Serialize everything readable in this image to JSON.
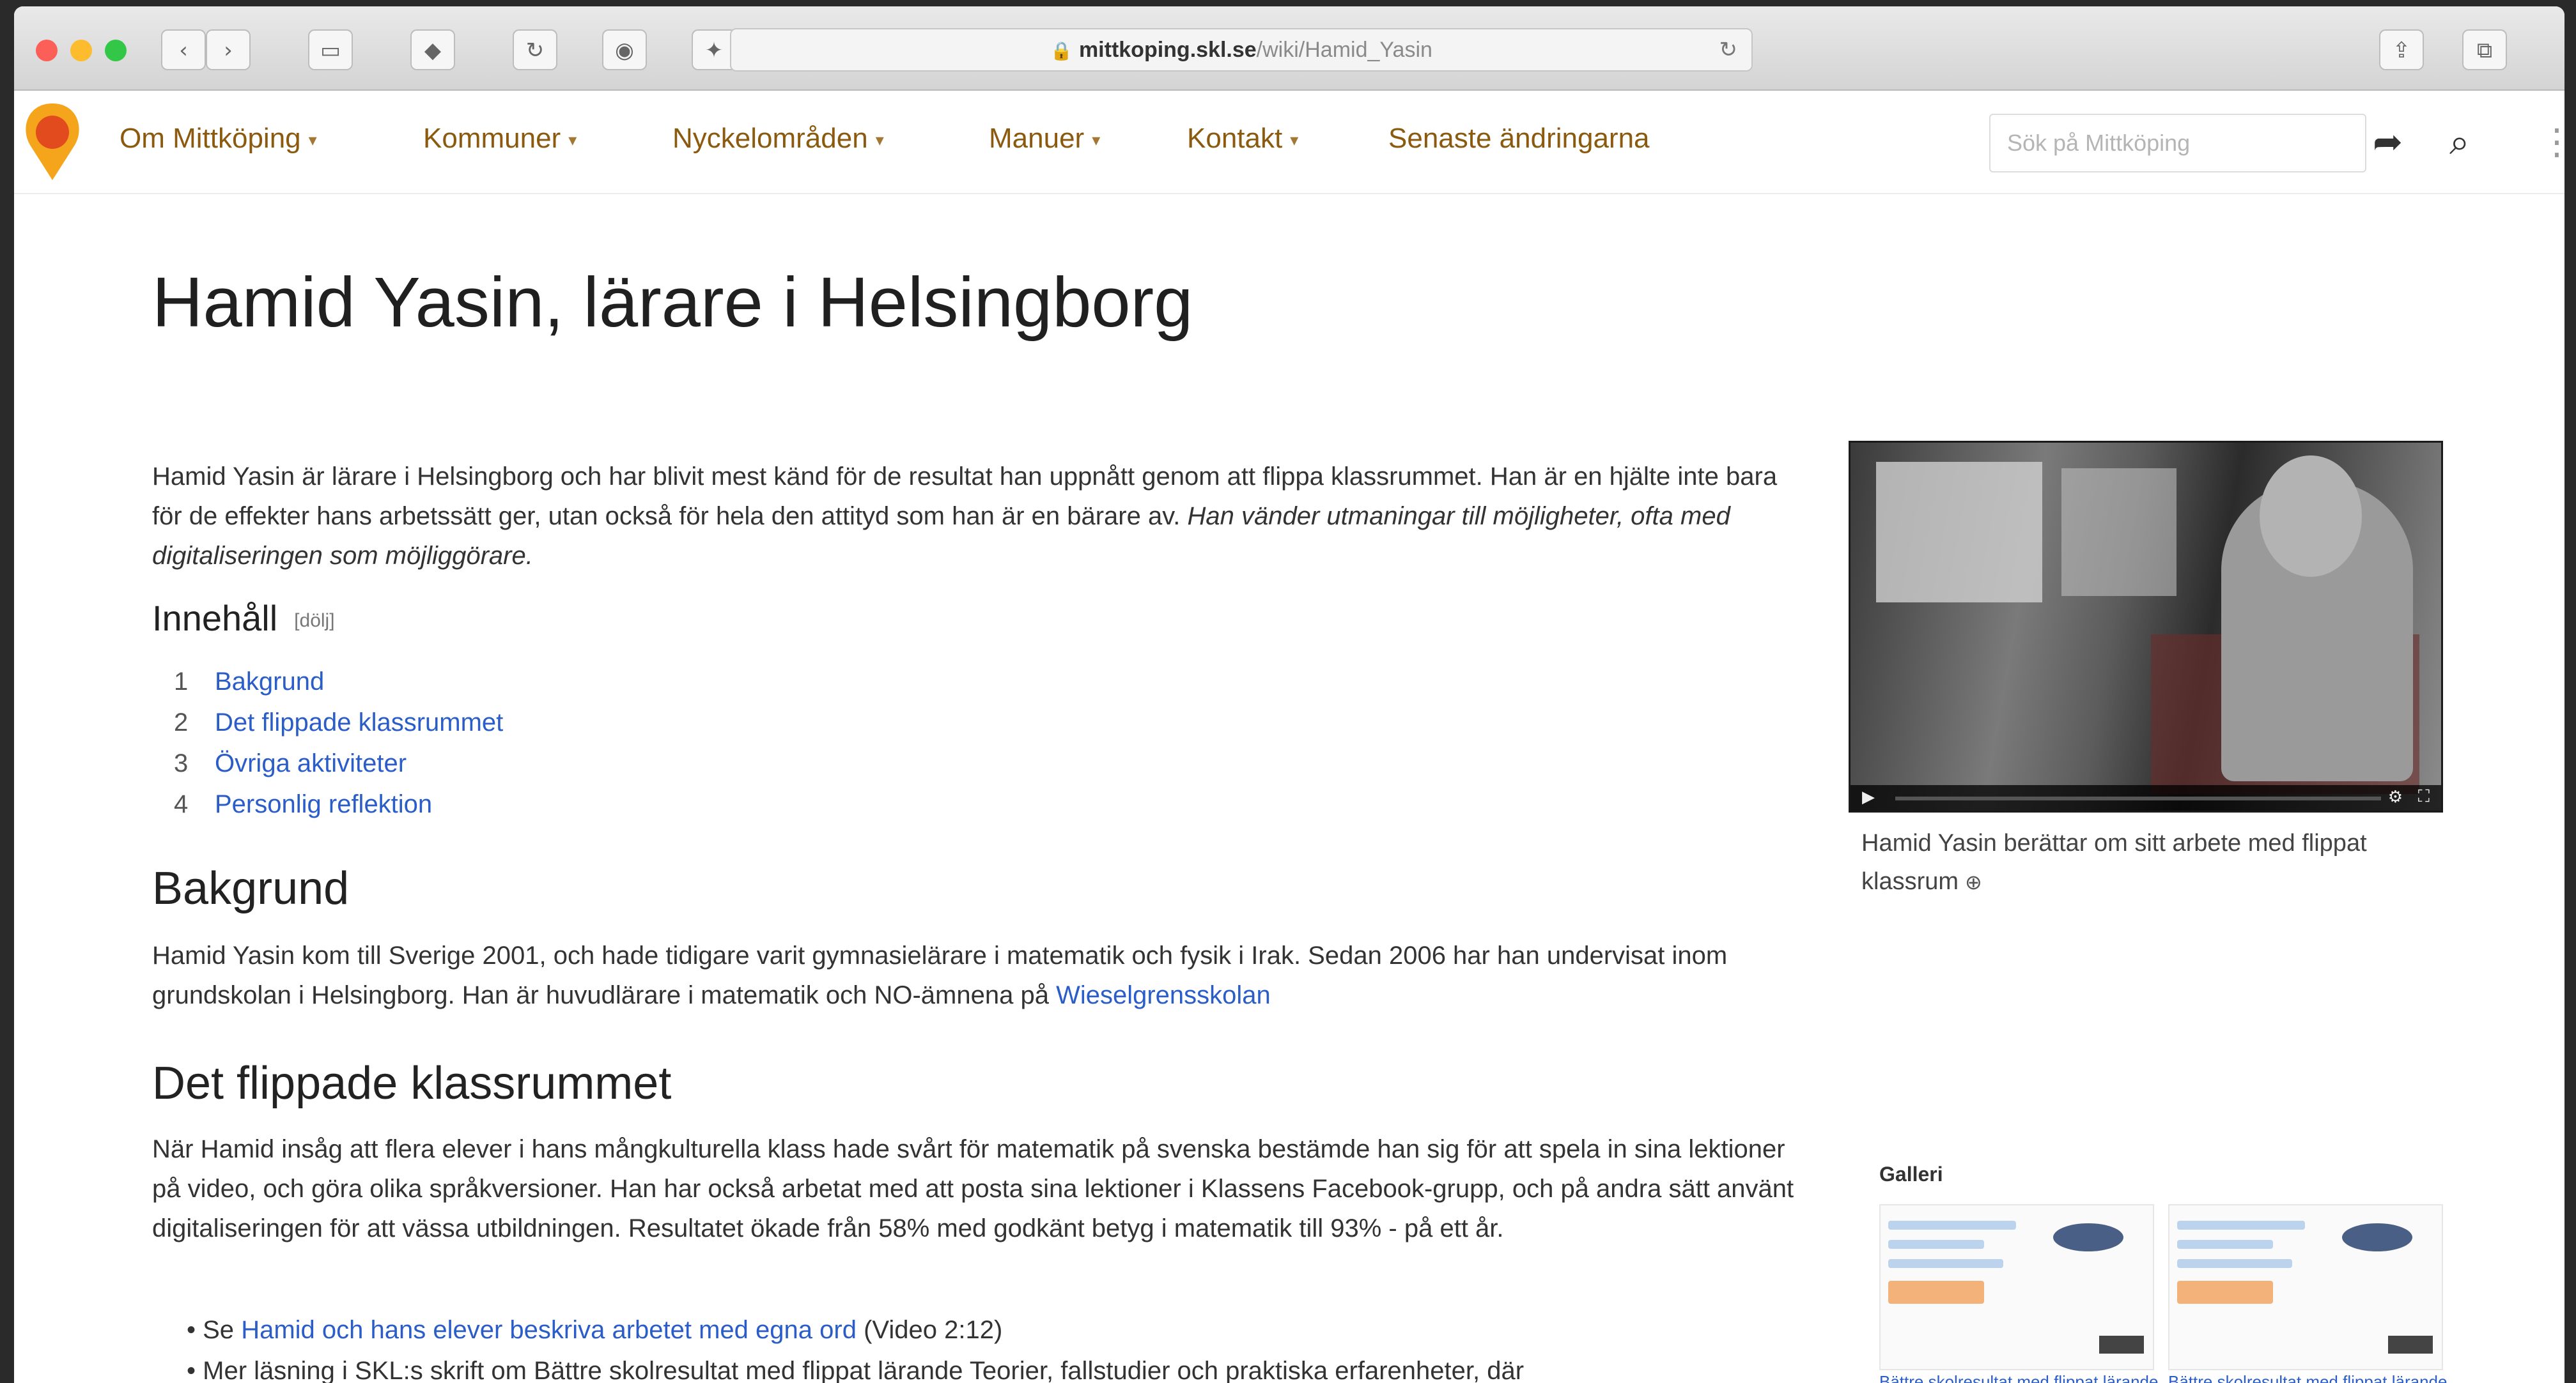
{
  "browser": {
    "url_host": "mittkoping.skl.se",
    "url_path": "/wiki/Hamid_Yasin",
    "lights": [
      "#fc5f57",
      "#fdbc2e",
      "#33c748"
    ]
  },
  "nav": {
    "items": [
      "Om Mittköping",
      "Kommuner",
      "Nyckelområden",
      "Manuer",
      "Kontakt",
      "Senaste ändringarna"
    ],
    "search_placeholder": "Sök på Mittköping",
    "accent": "#8b5a0e"
  },
  "article": {
    "title": "Hamid Yasin, lärare i Helsingborg",
    "intro": "Hamid Yasin är lärare i Helsingborg och har blivit mest känd för de resultat han uppnått genom att flippa klassrummet. Han är en hjälte inte bara för de effekter hans arbetssätt ger, utan också för hela den attityd som han är en bärare av.",
    "intro_em": "Han vänder utmaningar till möjligheter, ofta med digitaliseringen som möjliggörare.",
    "toc_title": "Innehåll",
    "toc_toggle": "[dölj]",
    "toc": [
      {
        "num": "1",
        "label": "Bakgrund"
      },
      {
        "num": "2",
        "label": "Det flippade klassrummet"
      },
      {
        "num": "3",
        "label": "Övriga aktiviteter"
      },
      {
        "num": "4",
        "label": "Personlig reflektion"
      }
    ],
    "bakgrund_heading": "Bakgrund",
    "bakgrund_text": "Hamid Yasin kom till Sverige 2001, och hade tidigare varit gymnasielärare i matematik och fysik i Irak. Sedan 2006 har han undervisat inom grundskolan i Helsingborg. Han är huvudlärare i matematik och NO-ämnena på",
    "bakgrund_link": "Wieselgrensskolan",
    "flipped_heading": "Det flippade klassrummet",
    "flipped_text": "När Hamid insåg att flera elever i hans mångkulturella klass hade svårt för matematik på svenska bestämde han sig för att spela in sina lektioner på video, och göra olika språkversioner. Han har också arbetat med att posta sina lektioner i Klassens Facebook-grupp, och på andra sätt använt digitaliseringen för att vässa utbildningen. Resultatet ökade från 58% med godkänt betyg i matematik till 93% - på ett år.",
    "bullet1_pre": "Se",
    "bullet1_link": "Hamid och hans elever beskriva arbetet med egna ord",
    "bullet1_post": "(Video 2:12)",
    "bullet2": "Mer läsning i SKL:s skrift om Bättre skolresultat med flippat lärande Teorier, fallstudier och praktiska erfarenheter, där"
  },
  "video": {
    "caption": "Hamid Yasin berättar om sitt arbete med flippat klassrum"
  },
  "gallery": {
    "label": "Galleri",
    "captions": [
      "Bättre skolresultat med flippat lärande",
      "Bättre skolresultat med flippat lärande"
    ]
  }
}
